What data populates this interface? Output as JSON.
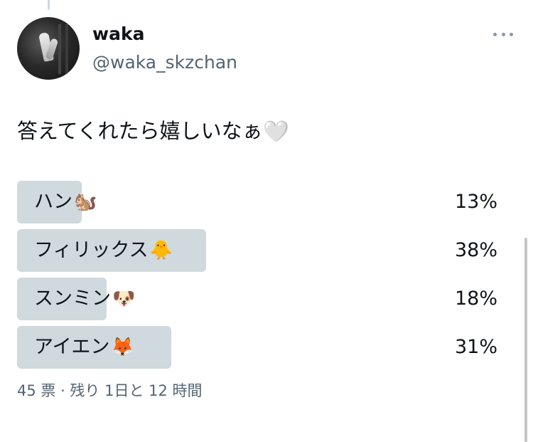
{
  "author": {
    "display_name": "waka",
    "handle": "@waka_skzchan"
  },
  "tweet": {
    "text": "答えてくれたら嬉しいなぁ",
    "emoji": "🤍"
  },
  "poll": {
    "options": [
      {
        "label": "ハン",
        "emoji": "🐿️",
        "percent_text": "13%",
        "percent": 13
      },
      {
        "label": "フィリックス",
        "emoji": "🐥",
        "percent_text": "38%",
        "percent": 38
      },
      {
        "label": "スンミン",
        "emoji": "🐶",
        "percent_text": "18%",
        "percent": 18
      },
      {
        "label": "アイエン",
        "emoji": "🦊",
        "percent_text": "31%",
        "percent": 31
      }
    ],
    "meta": "45 票 · 残り 1日と 12 時間"
  },
  "icons": {
    "more": "more-horizontal-icon",
    "heart": "white-heart-icon"
  },
  "colors": {
    "bar": "#cfd9de",
    "secondary_text": "#536471"
  }
}
